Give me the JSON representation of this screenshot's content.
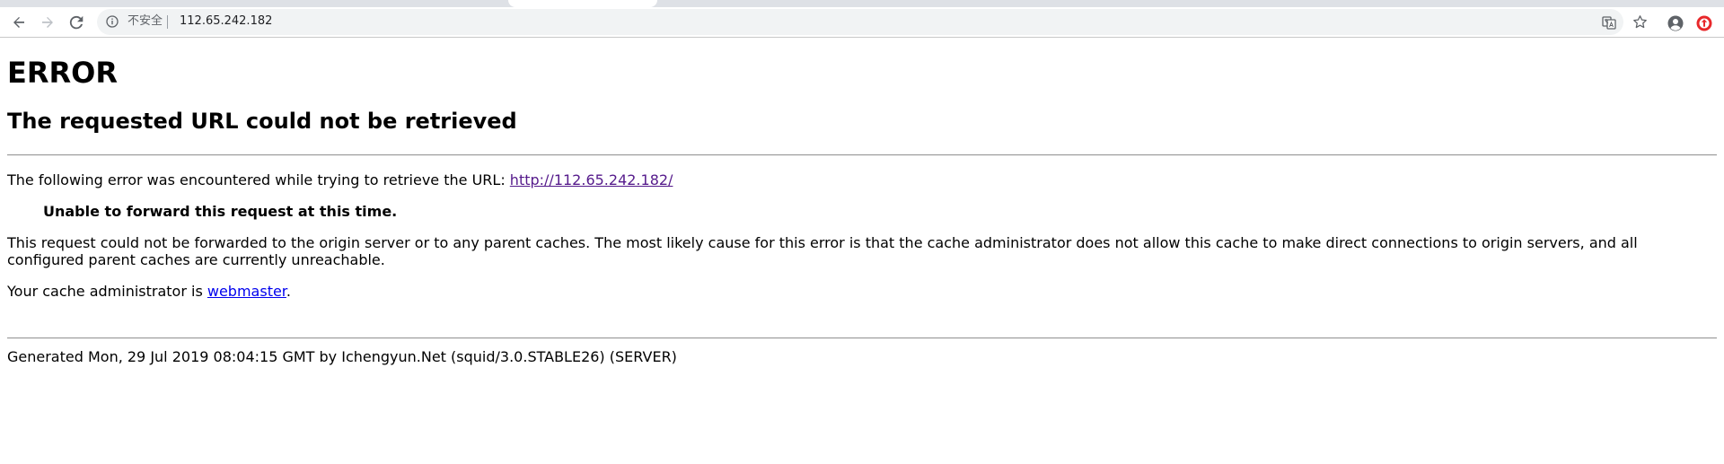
{
  "browser": {
    "security_label": "不安全",
    "address": "112.65.242.182",
    "icons": [
      "back-icon",
      "forward-icon",
      "reload-icon",
      "info-icon",
      "translate-icon",
      "star-icon",
      "account-icon",
      "extension-icon"
    ],
    "colors": {
      "toolbar_bg": "#ffffff",
      "omnibox_bg": "#f1f3f4",
      "extension_red": "#e8282b"
    }
  },
  "page": {
    "title": "ERROR",
    "subtitle": "The requested URL could not be retrieved",
    "intro_text": "The following error was encountered while trying to retrieve the URL: ",
    "intro_url": "http://112.65.242.182/",
    "error_message": "Unable to forward this request at this time.",
    "explanation": "This request could not be forwarded to the origin server or to any parent caches. The most likely cause for this error is that the cache administrator does not allow this cache to make direct connections to origin servers, and all configured parent caches are currently unreachable.",
    "admin_prefix": "Your cache administrator is ",
    "admin_link": "webmaster",
    "admin_suffix": ".",
    "footer": "Generated Mon, 29 Jul 2019 08:04:15 GMT by Ichengyun.Net (squid/3.0.STABLE26) (SERVER)"
  }
}
